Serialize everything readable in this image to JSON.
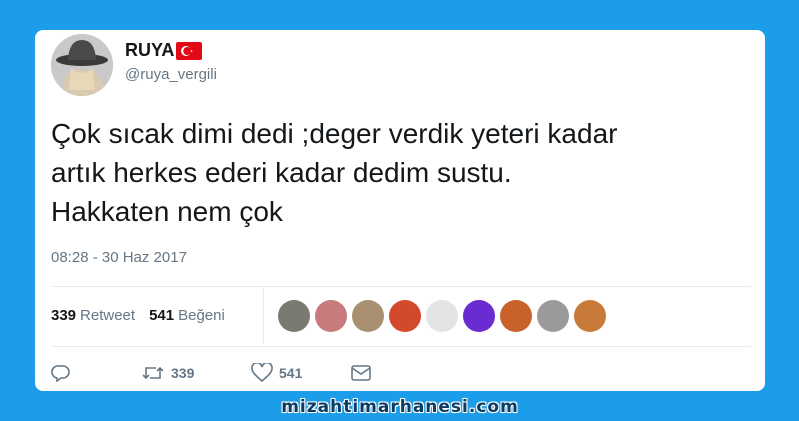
{
  "user": {
    "display_name": "RUYA",
    "flag_icon": "turkey-flag-icon",
    "handle": "@ruya_vergili"
  },
  "tweet": {
    "text_lines": [
      "Çok sıcak dimi dedi ;deger verdik yeteri kadar",
      "artık herkes ederi kadar dedim sustu.",
      "Hakkaten nem çok"
    ],
    "timestamp": "08:28 - 30 Haz 2017"
  },
  "stats": {
    "retweet_count": "339",
    "retweet_label": "Retweet",
    "like_count": "541",
    "like_label": "Beğeni"
  },
  "likers": [
    {
      "color": "#7a7a72"
    },
    {
      "color": "#c97b7b"
    },
    {
      "color": "#a89070"
    },
    {
      "color": "#d24a2b"
    },
    {
      "color": "#e4e4e4"
    },
    {
      "color": "#6a2bd0"
    },
    {
      "color": "#c8622a"
    },
    {
      "color": "#9a9a9a"
    },
    {
      "color": "#c87a3a"
    }
  ],
  "actions": {
    "reply_icon": "reply-icon",
    "retweet_icon": "retweet-icon",
    "retweet_count": "339",
    "like_icon": "heart-icon",
    "like_count": "541",
    "message_icon": "envelope-icon"
  },
  "watermark": "mizahtimarhanesi.com",
  "colors": {
    "background": "#1b9de9",
    "card": "#ffffff",
    "text": "#14171a",
    "secondary_text": "#657786",
    "flag_red": "#e30a17"
  }
}
